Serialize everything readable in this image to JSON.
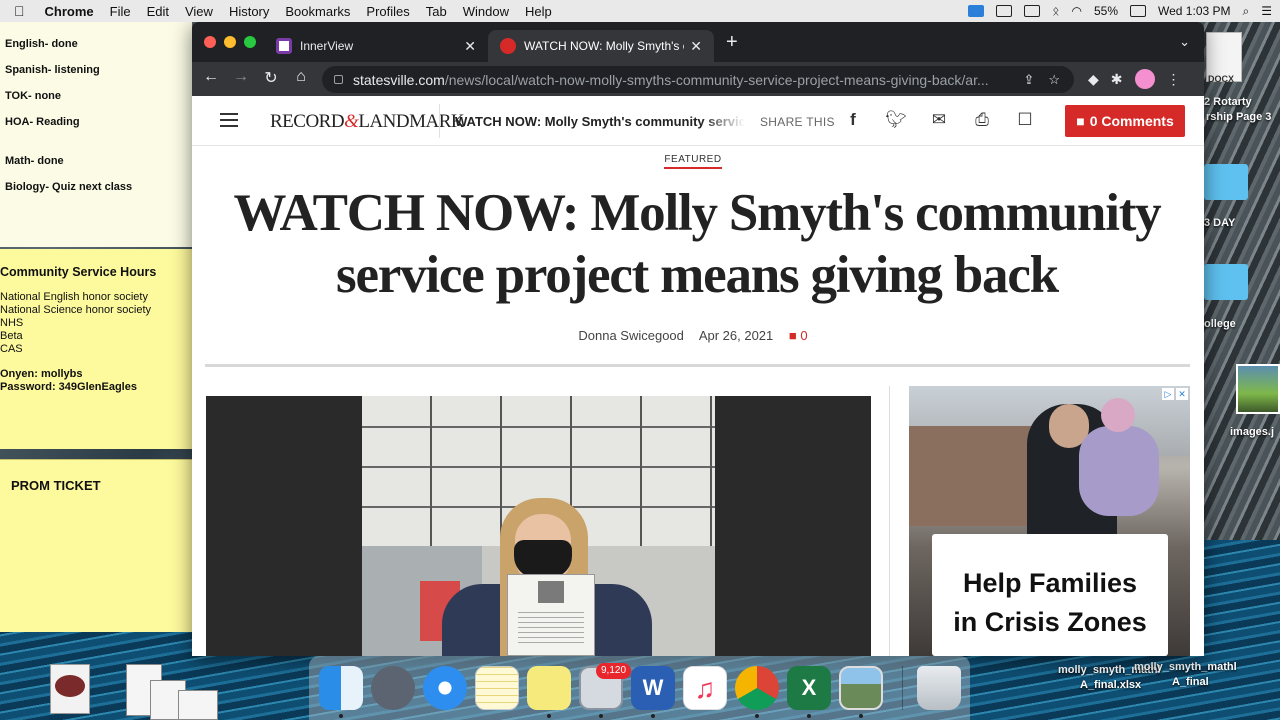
{
  "menubar": {
    "app": "Chrome",
    "items": [
      "File",
      "Edit",
      "View",
      "History",
      "Bookmarks",
      "Profiles",
      "Tab",
      "Window",
      "Help"
    ],
    "battery": "55%",
    "clock": "Wed 1:03 PM"
  },
  "stickies": {
    "subjects": [
      "English- done",
      "Spanish- listening",
      "TOK-  none",
      "HOA- Reading",
      "Math- done",
      "Biology- Quiz next class"
    ],
    "service": {
      "title": "Community Service Hours",
      "items": [
        "National English honor society",
        "National Science honor society",
        "NHS",
        "Beta",
        "CAS"
      ],
      "onyen": "Onyen: mollybs",
      "password": "Password: 349GlenEagles"
    },
    "prom": "PROM TICKET"
  },
  "desktop_files": {
    "docx": "DOCX",
    "rotary_1": "2 Rotarty",
    "rotary_2": "rship Page 3",
    "day": "3 DAY",
    "college": "ollege",
    "images": "images.j",
    "xlsx_1": "molly_smyth_mathl",
    "xlsx_1b": "A_final.xlsx",
    "xlsx_2": "molly_smyth_mathl",
    "xlsx_2b": "A_final"
  },
  "browser": {
    "tabs": [
      {
        "title": "InnerView"
      },
      {
        "title": "WATCH NOW: Molly Smyth's co"
      }
    ],
    "url_host": "statesville.com",
    "url_path": "/news/local/watch-now-molly-smyths-community-service-project-means-giving-back/ar..."
  },
  "site": {
    "logo_left": "RECORD",
    "logo_amp": "&",
    "logo_right": "LANDMARK",
    "header_title": "WATCH NOW: Molly Smyth's community service project means giving back",
    "share_label": "SHARE THIS",
    "comments_button": "0 Comments",
    "kicker": "FEATURED",
    "headline": "WATCH NOW: Molly Smyth's community service project means giving back",
    "author": "Donna Swicegood",
    "date": "Apr 26, 2021",
    "comment_count": "0"
  },
  "ad": {
    "headline_1": "Help Families",
    "headline_2": "in Crisis Zones"
  },
  "dock": {
    "mail_badge": "9,120"
  }
}
